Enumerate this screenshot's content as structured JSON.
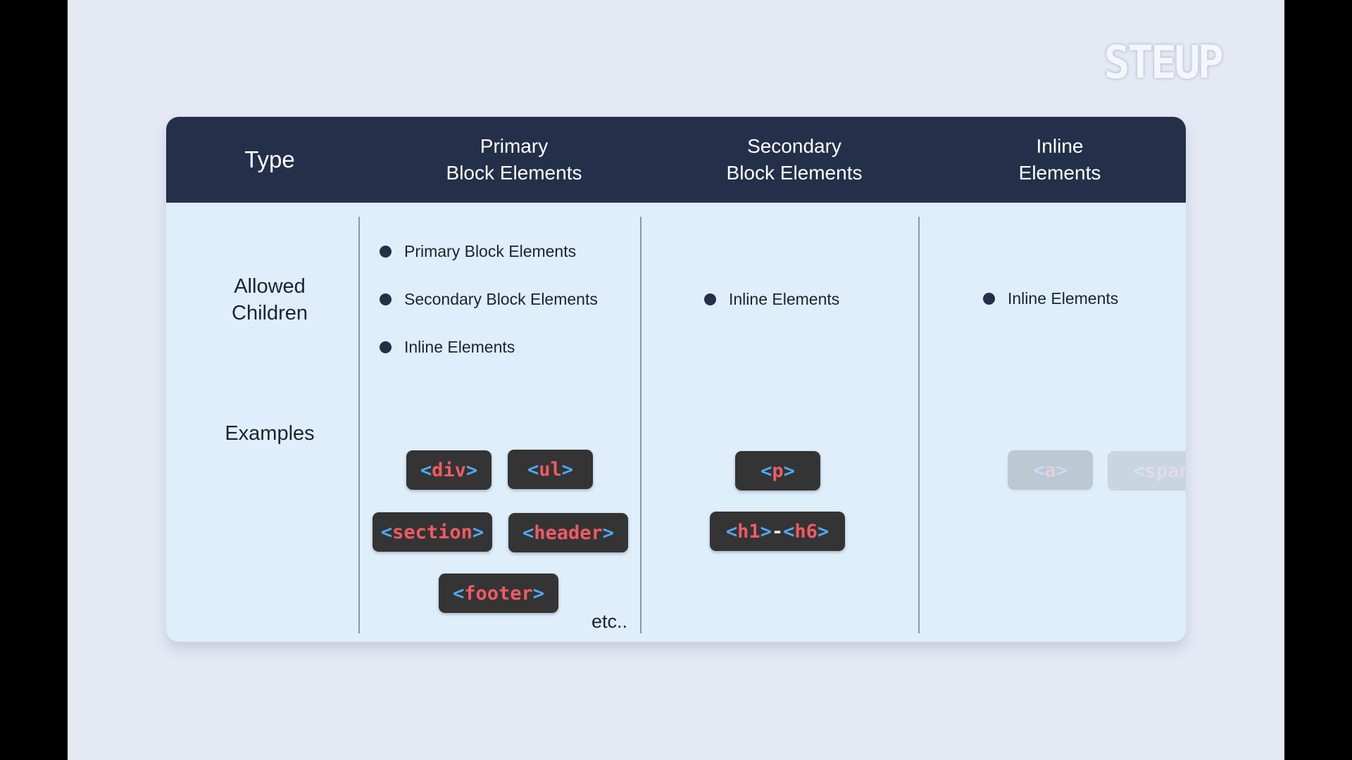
{
  "brand": {
    "logo": "STEUP"
  },
  "header": {
    "type": "Type",
    "col1": "Primary\nBlock Elements",
    "col2": "Secondary\nBlock Elements",
    "col3": "Inline\nElements"
  },
  "rows": {
    "allowed": "Allowed\nChildren",
    "examples": "Examples"
  },
  "primary": {
    "children": [
      "Primary Block Elements",
      "Secondary Block Elements",
      "Inline Elements"
    ],
    "tags": [
      "div",
      "ul",
      "section",
      "header",
      "footer"
    ],
    "etc": "etc.."
  },
  "secondary": {
    "children": [
      "Inline Elements"
    ],
    "tags": [
      "p"
    ],
    "heading_from": "h1",
    "heading_sep": "-",
    "heading_to": "h6"
  },
  "inline": {
    "children": [
      "Inline Elements"
    ],
    "tags": [
      "a",
      "span"
    ]
  },
  "brackets": {
    "open": "<",
    "close": ">"
  },
  "colors": {
    "background": "#e4e9f4",
    "header": "#243049",
    "card": "#dfeefb",
    "tag_bg": "#343434",
    "tag_bracket": "#4fa9f5",
    "tag_name": "#f25a63"
  }
}
